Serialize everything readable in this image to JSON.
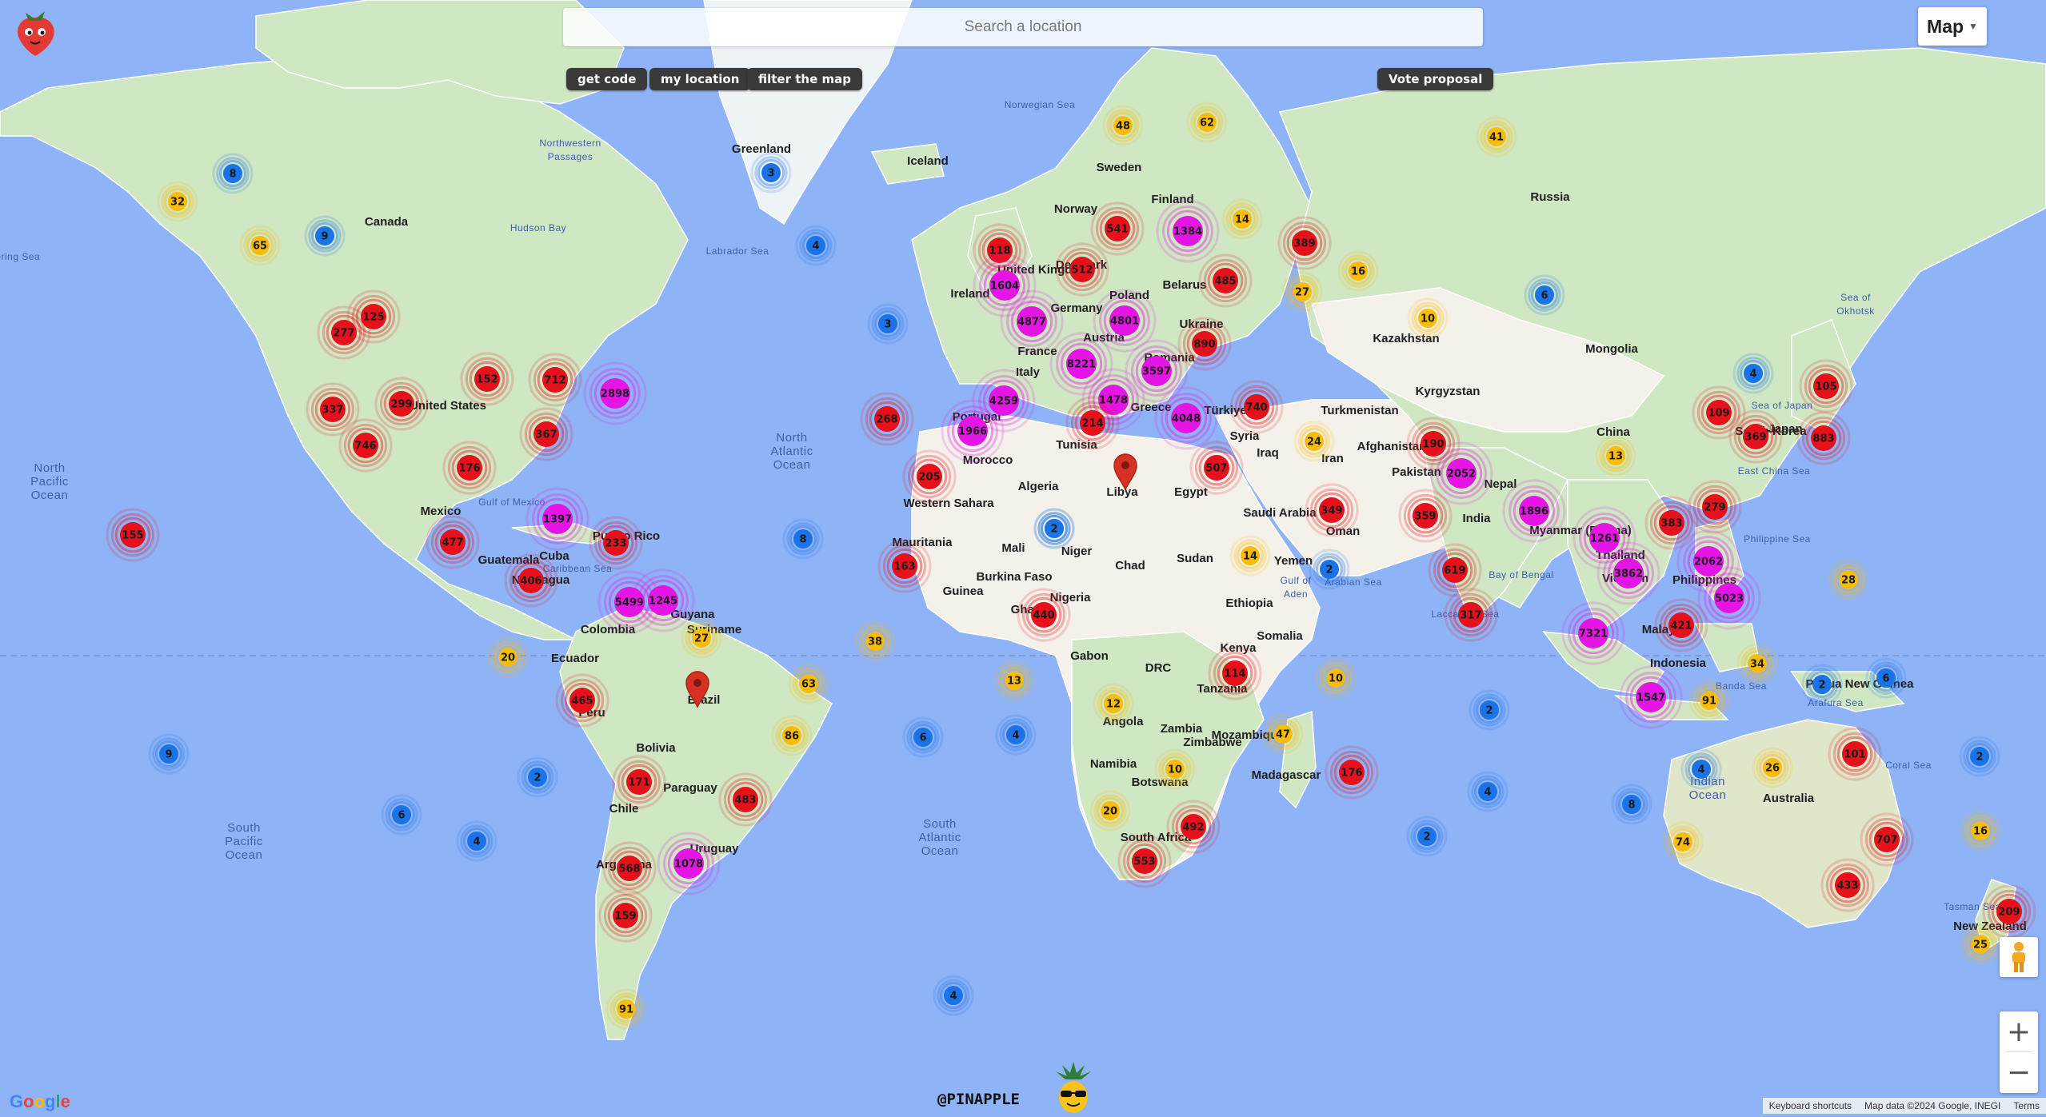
{
  "search": {
    "placeholder": "Search a location"
  },
  "buttons": {
    "get_code": "get code",
    "my_location": "my location",
    "filter_map": "filter the map",
    "vote_proposal": "Vote proposal"
  },
  "map_type": {
    "selected": "Map"
  },
  "attribution": {
    "shortcuts": "Keyboard shortcuts",
    "map_data": "Map data ©2024 Google, INEGI",
    "terms": "Terms"
  },
  "google_logo": "Google",
  "brand": "@PINAPPLE",
  "colors": {
    "ocean": "#8fb3f7",
    "land": "#cfe7c3",
    "cluster_blue": "#1a73e8",
    "cluster_yellow": "#fbbc05",
    "cluster_red": "#e8101a",
    "cluster_magenta": "#e515e5",
    "pin": "#d93025"
  },
  "ocean_labels": [
    {
      "text": "North Pacific Ocean"
    },
    {
      "text": "North Atlantic Ocean"
    },
    {
      "text": "South Pacific Ocean"
    },
    {
      "text": "South Atlantic Ocean"
    },
    {
      "text": "Indian Ocean"
    },
    {
      "text": "Arabian Sea"
    },
    {
      "text": "Bay of Bengal"
    },
    {
      "text": "Hudson Bay"
    },
    {
      "text": "Labrador Sea"
    },
    {
      "text": "Norwegian Sea"
    },
    {
      "text": "Philippine Sea"
    },
    {
      "text": "Sea of Japan"
    },
    {
      "text": "Coral Sea"
    },
    {
      "text": "Tasman Sea"
    },
    {
      "text": "Caribbean Sea"
    },
    {
      "text": "Gulf of Mexico"
    },
    {
      "text": "Gulf of Aden"
    },
    {
      "text": "Sea of Okhotsk"
    },
    {
      "text": "Arafura Sea"
    },
    {
      "text": "Banda Sea"
    },
    {
      "text": "East China Sea"
    },
    {
      "text": "Laccadive Sea"
    },
    {
      "text": "Northwestern Passages"
    },
    {
      "text": "Bering Sea"
    }
  ],
  "place_labels": [
    {
      "text": "Canada"
    },
    {
      "text": "United States"
    },
    {
      "text": "Mexico"
    },
    {
      "text": "Guatemala"
    },
    {
      "text": "Cuba"
    },
    {
      "text": "Puerto Rico"
    },
    {
      "text": "Nicaragua"
    },
    {
      "text": "Colombia"
    },
    {
      "text": "Guyana"
    },
    {
      "text": "Suriname"
    },
    {
      "text": "Ecuador"
    },
    {
      "text": "Peru"
    },
    {
      "text": "Brazil"
    },
    {
      "text": "Bolivia"
    },
    {
      "text": "Paraguay"
    },
    {
      "text": "Chile"
    },
    {
      "text": "Argentina"
    },
    {
      "text": "Uruguay"
    },
    {
      "text": "Greenland"
    },
    {
      "text": "Iceland"
    },
    {
      "text": "Sweden"
    },
    {
      "text": "Norway"
    },
    {
      "text": "Finland"
    },
    {
      "text": "Denmark"
    },
    {
      "text": "United Kingdom"
    },
    {
      "text": "Ireland"
    },
    {
      "text": "Germany"
    },
    {
      "text": "Poland"
    },
    {
      "text": "Belarus"
    },
    {
      "text": "Ukraine"
    },
    {
      "text": "France"
    },
    {
      "text": "Austria"
    },
    {
      "text": "Romania"
    },
    {
      "text": "Italy"
    },
    {
      "text": "Portugal"
    },
    {
      "text": "Greece"
    },
    {
      "text": "Türkiye"
    },
    {
      "text": "Tunisia"
    },
    {
      "text": "Morocco"
    },
    {
      "text": "Algeria"
    },
    {
      "text": "Libya"
    },
    {
      "text": "Egypt"
    },
    {
      "text": "Western Sahara"
    },
    {
      "text": "Mauritania"
    },
    {
      "text": "Mali"
    },
    {
      "text": "Niger"
    },
    {
      "text": "Chad"
    },
    {
      "text": "Sudan"
    },
    {
      "text": "Burkina Faso"
    },
    {
      "text": "Guinea"
    },
    {
      "text": "Ghana"
    },
    {
      "text": "Nigeria"
    },
    {
      "text": "Ethiopia"
    },
    {
      "text": "Somalia"
    },
    {
      "text": "Kenya"
    },
    {
      "text": "Gabon"
    },
    {
      "text": "DRC"
    },
    {
      "text": "Tanzania"
    },
    {
      "text": "Angola"
    },
    {
      "text": "Zambia"
    },
    {
      "text": "Zimbabwe"
    },
    {
      "text": "Mozambique"
    },
    {
      "text": "Namibia"
    },
    {
      "text": "Botswana"
    },
    {
      "text": "South Africa"
    },
    {
      "text": "Madagascar"
    },
    {
      "text": "Syria"
    },
    {
      "text": "Iraq"
    },
    {
      "text": "Iran"
    },
    {
      "text": "Saudi Arabia"
    },
    {
      "text": "Oman"
    },
    {
      "text": "Yemen"
    },
    {
      "text": "Afghanistan"
    },
    {
      "text": "Pakistan"
    },
    {
      "text": "Turkmenistan"
    },
    {
      "text": "Kazakhstan"
    },
    {
      "text": "Kyrgyzstan"
    },
    {
      "text": "Russia"
    },
    {
      "text": "Mongolia"
    },
    {
      "text": "China"
    },
    {
      "text": "Nepal"
    },
    {
      "text": "India"
    },
    {
      "text": "Myanmar (Burma)"
    },
    {
      "text": "Thailand"
    },
    {
      "text": "Vietnam"
    },
    {
      "text": "Malaysia"
    },
    {
      "text": "Philippines"
    },
    {
      "text": "Indonesia"
    },
    {
      "text": "Papua New Guinea"
    },
    {
      "text": "South Korea"
    },
    {
      "text": "Japan"
    },
    {
      "text": "Australia"
    },
    {
      "text": "New Zealand"
    }
  ],
  "pins": [
    {
      "name": "pin-libya"
    },
    {
      "name": "pin-brazil"
    }
  ],
  "clusters": [
    {
      "count": 8,
      "level": "blue"
    },
    {
      "count": 32,
      "level": "yellow"
    },
    {
      "count": 9,
      "level": "blue"
    },
    {
      "count": 65,
      "level": "yellow"
    },
    {
      "count": 125,
      "level": "red"
    },
    {
      "count": 277,
      "level": "red"
    },
    {
      "count": 152,
      "level": "red"
    },
    {
      "count": 712,
      "level": "red"
    },
    {
      "count": 2898,
      "level": "magenta"
    },
    {
      "count": 337,
      "level": "red"
    },
    {
      "count": 299,
      "level": "red"
    },
    {
      "count": 367,
      "level": "red"
    },
    {
      "count": 746,
      "level": "red"
    },
    {
      "count": 176,
      "level": "red"
    },
    {
      "count": 1397,
      "level": "magenta"
    },
    {
      "count": 155,
      "level": "red"
    },
    {
      "count": 477,
      "level": "red"
    },
    {
      "count": 233,
      "level": "red"
    },
    {
      "count": 406,
      "level": "red"
    },
    {
      "count": 5499,
      "level": "magenta"
    },
    {
      "count": 1245,
      "level": "magenta"
    },
    {
      "count": 27,
      "level": "yellow"
    },
    {
      "count": 20,
      "level": "yellow"
    },
    {
      "count": 465,
      "level": "red"
    },
    {
      "count": 63,
      "level": "yellow"
    },
    {
      "count": 86,
      "level": "yellow"
    },
    {
      "count": 9,
      "level": "blue"
    },
    {
      "count": 2,
      "level": "blue"
    },
    {
      "count": 171,
      "level": "red"
    },
    {
      "count": 483,
      "level": "red"
    },
    {
      "count": 6,
      "level": "blue"
    },
    {
      "count": 4,
      "level": "blue"
    },
    {
      "count": 568,
      "level": "red"
    },
    {
      "count": 1078,
      "level": "magenta"
    },
    {
      "count": 159,
      "level": "red"
    },
    {
      "count": 91,
      "level": "yellow"
    },
    {
      "count": 3,
      "level": "blue"
    },
    {
      "count": 4,
      "level": "blue"
    },
    {
      "count": 268,
      "level": "red"
    },
    {
      "count": 8,
      "level": "blue"
    },
    {
      "count": 38,
      "level": "yellow"
    },
    {
      "count": 13,
      "level": "yellow"
    },
    {
      "count": 6,
      "level": "blue"
    },
    {
      "count": 4,
      "level": "blue"
    },
    {
      "count": 3,
      "level": "blue"
    },
    {
      "count": 2,
      "level": "blue"
    },
    {
      "count": 48,
      "level": "yellow"
    },
    {
      "count": 62,
      "level": "yellow"
    },
    {
      "count": 118,
      "level": "red"
    },
    {
      "count": 1604,
      "level": "magenta"
    },
    {
      "count": 512,
      "level": "red"
    },
    {
      "count": 541,
      "level": "red"
    },
    {
      "count": 1384,
      "level": "magenta"
    },
    {
      "count": 14,
      "level": "yellow"
    },
    {
      "count": 389,
      "level": "red"
    },
    {
      "count": 16,
      "level": "yellow"
    },
    {
      "count": 4877,
      "level": "magenta"
    },
    {
      "count": 4801,
      "level": "magenta"
    },
    {
      "count": 485,
      "level": "red"
    },
    {
      "count": 27,
      "level": "yellow"
    },
    {
      "count": 890,
      "level": "red"
    },
    {
      "count": 8221,
      "level": "magenta"
    },
    {
      "count": 3597,
      "level": "magenta"
    },
    {
      "count": 4259,
      "level": "magenta"
    },
    {
      "count": 1478,
      "level": "magenta"
    },
    {
      "count": 1966,
      "level": "magenta"
    },
    {
      "count": 214,
      "level": "red"
    },
    {
      "count": 4048,
      "level": "magenta"
    },
    {
      "count": 740,
      "level": "red"
    },
    {
      "count": 205,
      "level": "red"
    },
    {
      "count": 507,
      "level": "red"
    },
    {
      "count": 163,
      "level": "red"
    },
    {
      "count": 2,
      "level": "blue"
    },
    {
      "count": 440,
      "level": "red"
    },
    {
      "count": 14,
      "level": "yellow"
    },
    {
      "count": 349,
      "level": "red"
    },
    {
      "count": 2,
      "level": "blue"
    },
    {
      "count": 114,
      "level": "red"
    },
    {
      "count": 12,
      "level": "yellow"
    },
    {
      "count": 47,
      "level": "yellow"
    },
    {
      "count": 10,
      "level": "yellow"
    },
    {
      "count": 20,
      "level": "yellow"
    },
    {
      "count": 492,
      "level": "red"
    },
    {
      "count": 553,
      "level": "red"
    },
    {
      "count": 176,
      "level": "red"
    },
    {
      "count": 10,
      "level": "yellow"
    },
    {
      "count": 4,
      "level": "blue"
    },
    {
      "count": 2,
      "level": "blue"
    },
    {
      "count": 4,
      "level": "blue"
    },
    {
      "count": 8,
      "level": "blue"
    },
    {
      "count": 41,
      "level": "yellow"
    },
    {
      "count": 10,
      "level": "yellow"
    },
    {
      "count": 6,
      "level": "blue"
    },
    {
      "count": 2,
      "level": "blue"
    },
    {
      "count": 24,
      "level": "yellow"
    },
    {
      "count": 190,
      "level": "red"
    },
    {
      "count": 2052,
      "level": "magenta"
    },
    {
      "count": 359,
      "level": "red"
    },
    {
      "count": 1896,
      "level": "magenta"
    },
    {
      "count": 619,
      "level": "red"
    },
    {
      "count": 317,
      "level": "red"
    },
    {
      "count": 13,
      "level": "yellow"
    },
    {
      "count": 4,
      "level": "blue"
    },
    {
      "count": 109,
      "level": "red"
    },
    {
      "count": 369,
      "level": "red"
    },
    {
      "count": 105,
      "level": "red"
    },
    {
      "count": 883,
      "level": "red"
    },
    {
      "count": 279,
      "level": "red"
    },
    {
      "count": 1261,
      "level": "magenta"
    },
    {
      "count": 383,
      "level": "red"
    },
    {
      "count": 3862,
      "level": "magenta"
    },
    {
      "count": 2062,
      "level": "magenta"
    },
    {
      "count": 5023,
      "level": "magenta"
    },
    {
      "count": 28,
      "level": "yellow"
    },
    {
      "count": 7321,
      "level": "magenta"
    },
    {
      "count": 421,
      "level": "red"
    },
    {
      "count": 34,
      "level": "yellow"
    },
    {
      "count": 1547,
      "level": "magenta"
    },
    {
      "count": 91,
      "level": "yellow"
    },
    {
      "count": 2,
      "level": "blue"
    },
    {
      "count": 6,
      "level": "blue"
    },
    {
      "count": 4,
      "level": "blue"
    },
    {
      "count": 26,
      "level": "yellow"
    },
    {
      "count": 101,
      "level": "red"
    },
    {
      "count": 2,
      "level": "blue"
    },
    {
      "count": 74,
      "level": "yellow"
    },
    {
      "count": 707,
      "level": "red"
    },
    {
      "count": 16,
      "level": "yellow"
    },
    {
      "count": 433,
      "level": "red"
    },
    {
      "count": 209,
      "level": "red"
    },
    {
      "count": 25,
      "level": "yellow"
    }
  ]
}
